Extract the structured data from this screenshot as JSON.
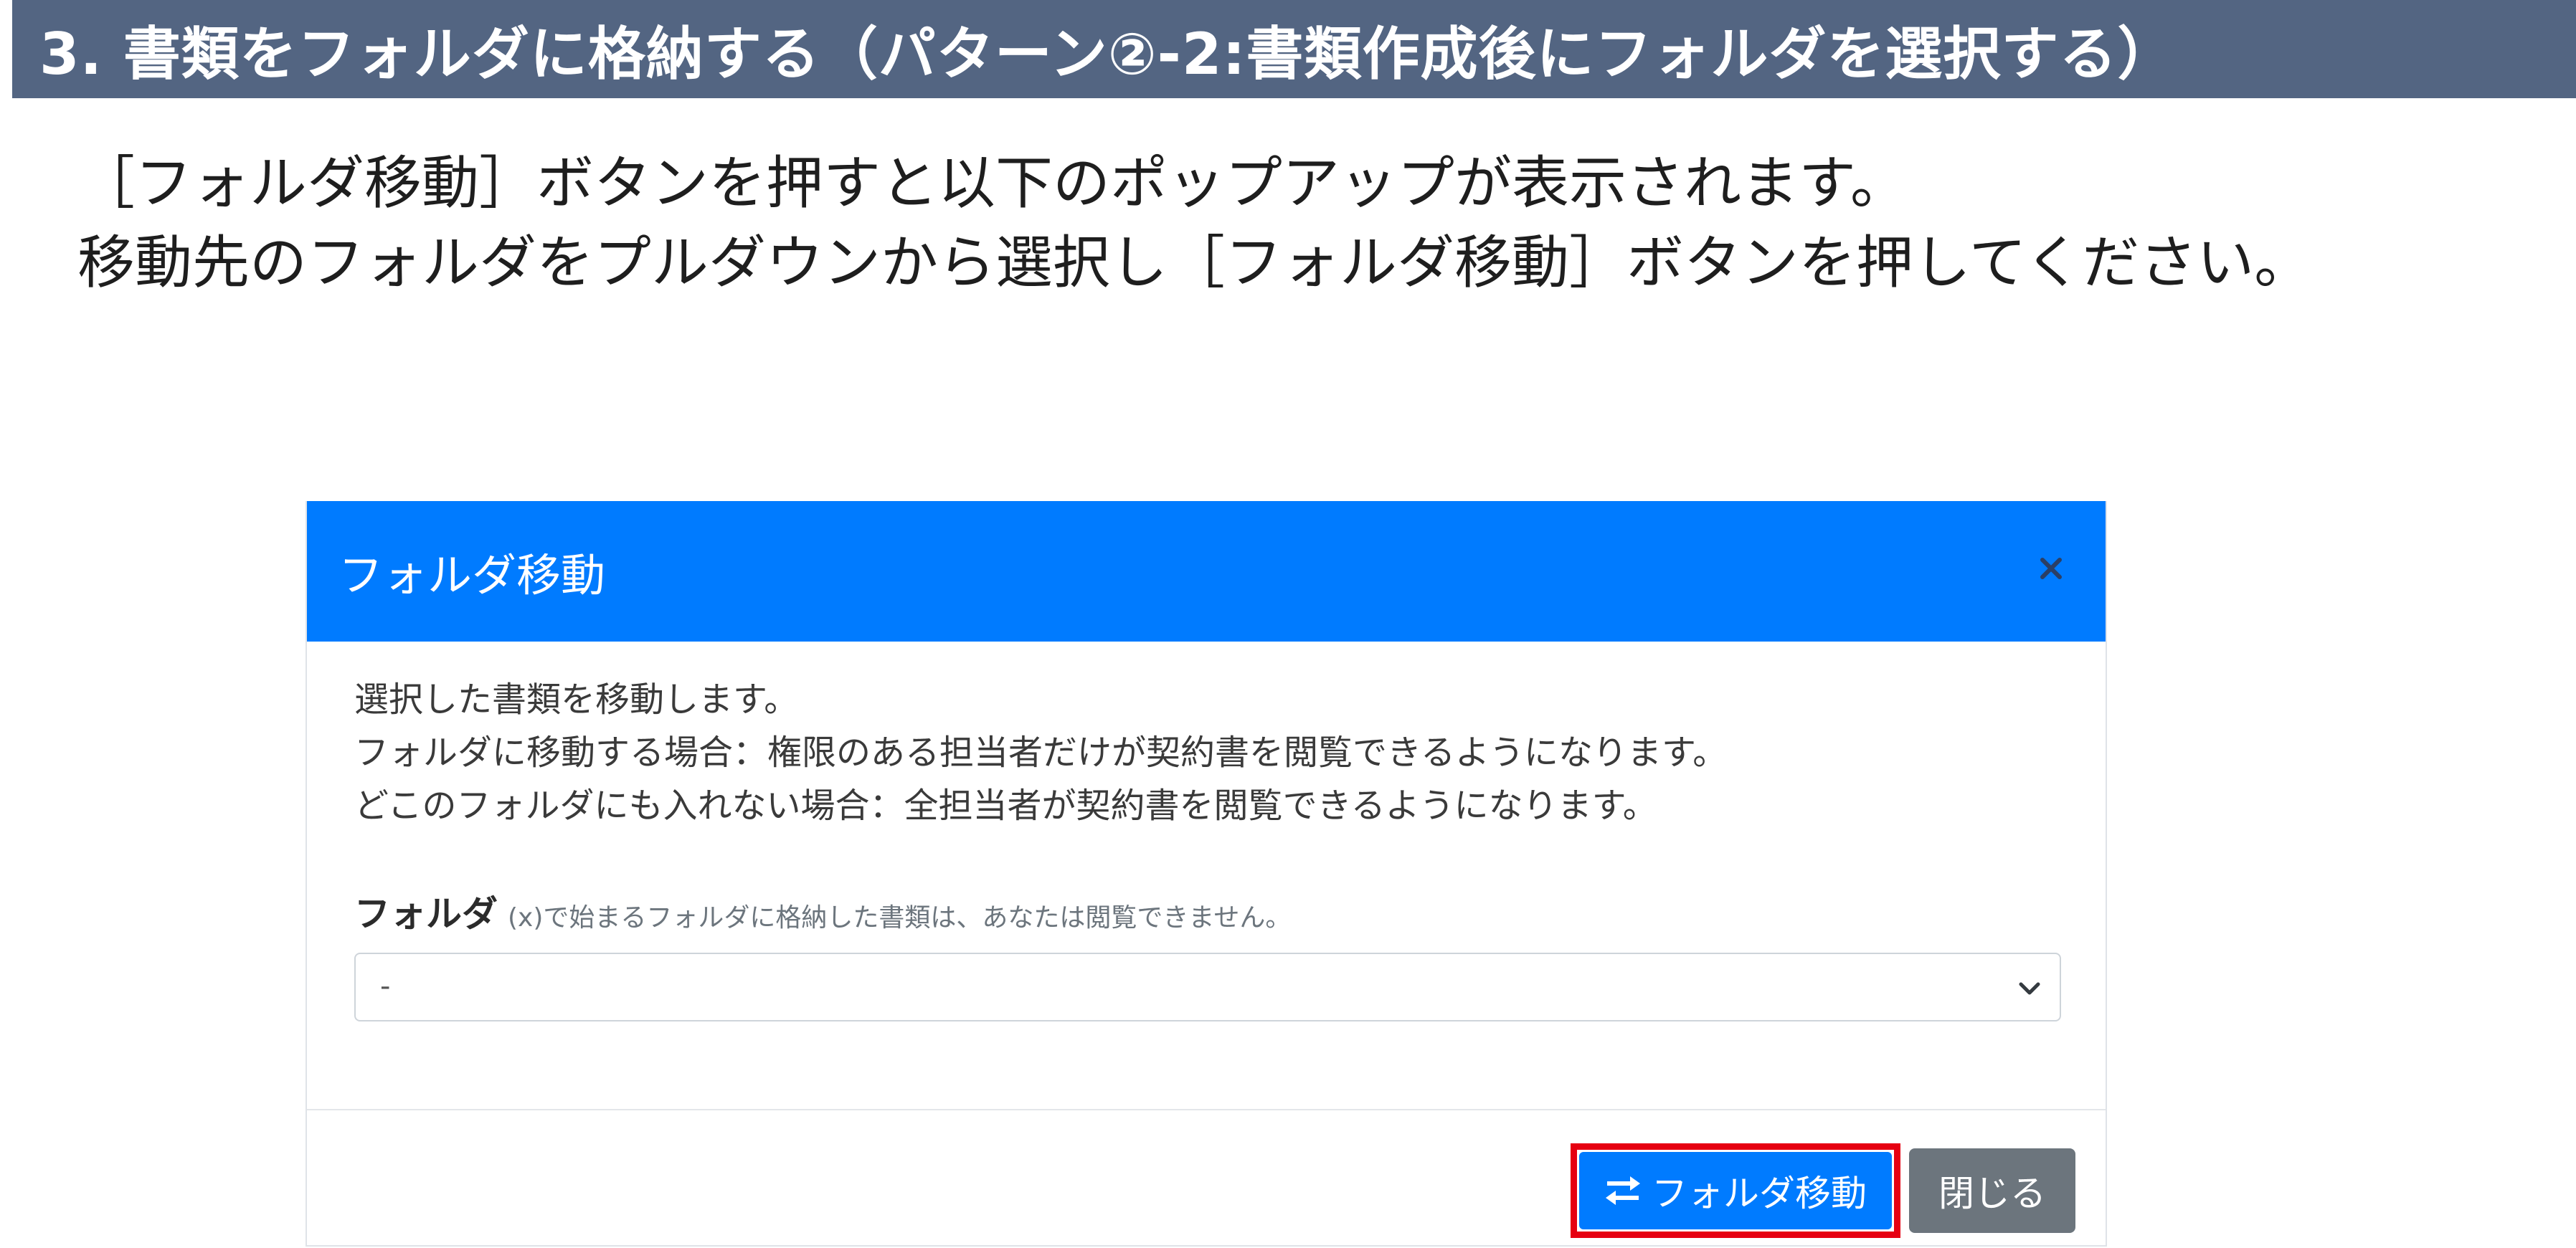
{
  "slide": {
    "title": "3. 書類をフォルダに格納する（パターン②-2:書類作成後にフォルダを選択する）",
    "instructions": [
      "［フォルダ移動］ボタンを押すと以下のポップアップが表示されます。",
      "移動先のフォルダをプルダウンから選択し［フォルダ移動］ボタンを押してください。"
    ]
  },
  "modal": {
    "title": "フォルダ移動",
    "close_icon": "close-icon",
    "description": [
      "選択した書類を移動します。",
      "フォルダに移動する場合：権限のある担当者だけが契約書を閲覧できるようになります。",
      "どこのフォルダにも入れない場合：全担当者が契約書を閲覧できるようになります。"
    ],
    "field_label": "フォルダ",
    "field_hint": "(x)で始まるフォルダに格納した書類は、あなたは閲覧できません。",
    "select_value": "-",
    "move_button_label": "フォルダ移動",
    "move_button_icon": "swap-arrows-icon",
    "close_button_label": "閉じる"
  },
  "colors": {
    "title_bar": "#536582",
    "modal_header": "#007bff",
    "primary_button": "#007bff",
    "secondary_button": "#6c757d",
    "highlight_box": "#e60012"
  }
}
